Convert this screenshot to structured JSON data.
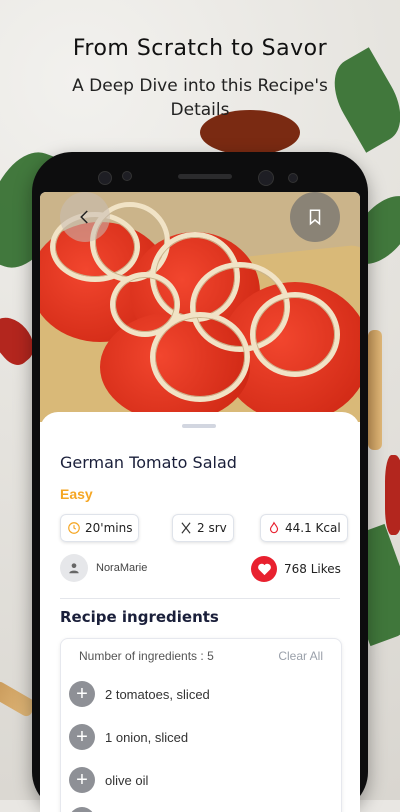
{
  "promo": {
    "title": "From Scratch to Savor",
    "subtitle": "A Deep Dive into this Recipe's Details"
  },
  "recipe": {
    "title": "German Tomato Salad",
    "difficulty": "Easy",
    "stats": {
      "time": "20'mins",
      "servings": "2 srv",
      "calories": "44.1 Kcal"
    },
    "author": "NoraMarie",
    "likes": "768 Likes"
  },
  "ingredients": {
    "section_title": "Recipe ingredients",
    "count_label": "Number of ingredients : 5",
    "clear_all": "Clear All",
    "items": [
      {
        "name": "2 tomatoes, sliced"
      },
      {
        "name": "1 onion, sliced"
      },
      {
        "name": "olive oil"
      }
    ]
  },
  "colors": {
    "difficulty": "#f5a623",
    "like": "#e8212f",
    "title": "#1a1f3a"
  },
  "icons": {
    "back": "chevron-left-icon",
    "bookmark": "bookmark-icon",
    "time": "clock-icon",
    "servings": "utensils-icon",
    "calories": "flame-icon",
    "author": "user-icon",
    "like": "heart-icon",
    "add": "plus-icon"
  }
}
